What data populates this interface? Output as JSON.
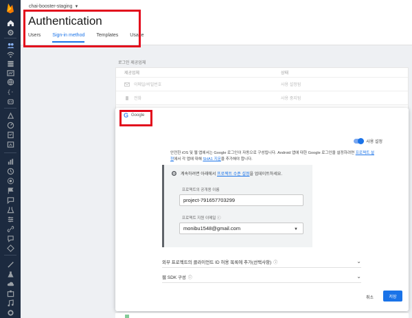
{
  "header": {
    "project_name": "chai-booster-staging",
    "title": "Authentication",
    "tabs": [
      "Users",
      "Sign-in method",
      "Templates",
      "Usage"
    ],
    "active_tab": "Sign-in method"
  },
  "providers_section": {
    "label": "로그인 제공업체",
    "header_cols": [
      "제공업체",
      "상태"
    ],
    "rows": [
      {
        "name": "이메일/비밀번호",
        "status": "사용 설정됨"
      },
      {
        "name": "전화",
        "status": "사용 중지됨"
      }
    ]
  },
  "google_panel": {
    "provider_name": "Google",
    "enable_label": "사용 설정",
    "enabled": true,
    "description_pre": "안전한 iOS 및 웹 앱에서는 Google 로그인이 자동으로 구성됩니다. Android 앱에 대한 Google 로그인을 설정하려면",
    "description_link1": "프로젝트 설정",
    "description_mid": "에서 각 앱에 대해",
    "description_link2": "SHA1 지문",
    "description_post": "을 추가해야 합니다.",
    "config_notice_pre": "계속하려면 아래에서",
    "config_notice_link": "프로젝트 수준 설정",
    "config_notice_post": "을 업데이트하세요.",
    "public_name_label": "프로젝트의 공개용 이름",
    "public_name_value": "project-791657703299",
    "support_email_label": "프로젝트 지원 이메일",
    "support_email_value": "monibu1548@gmail.com",
    "expander1_label": "외부 프로젝트의 클라이언트 ID 허용 목록에 추가(선택사항)",
    "expander2_label": "웹 SDK 구성",
    "cancel_label": "취소",
    "save_label": "저장"
  }
}
